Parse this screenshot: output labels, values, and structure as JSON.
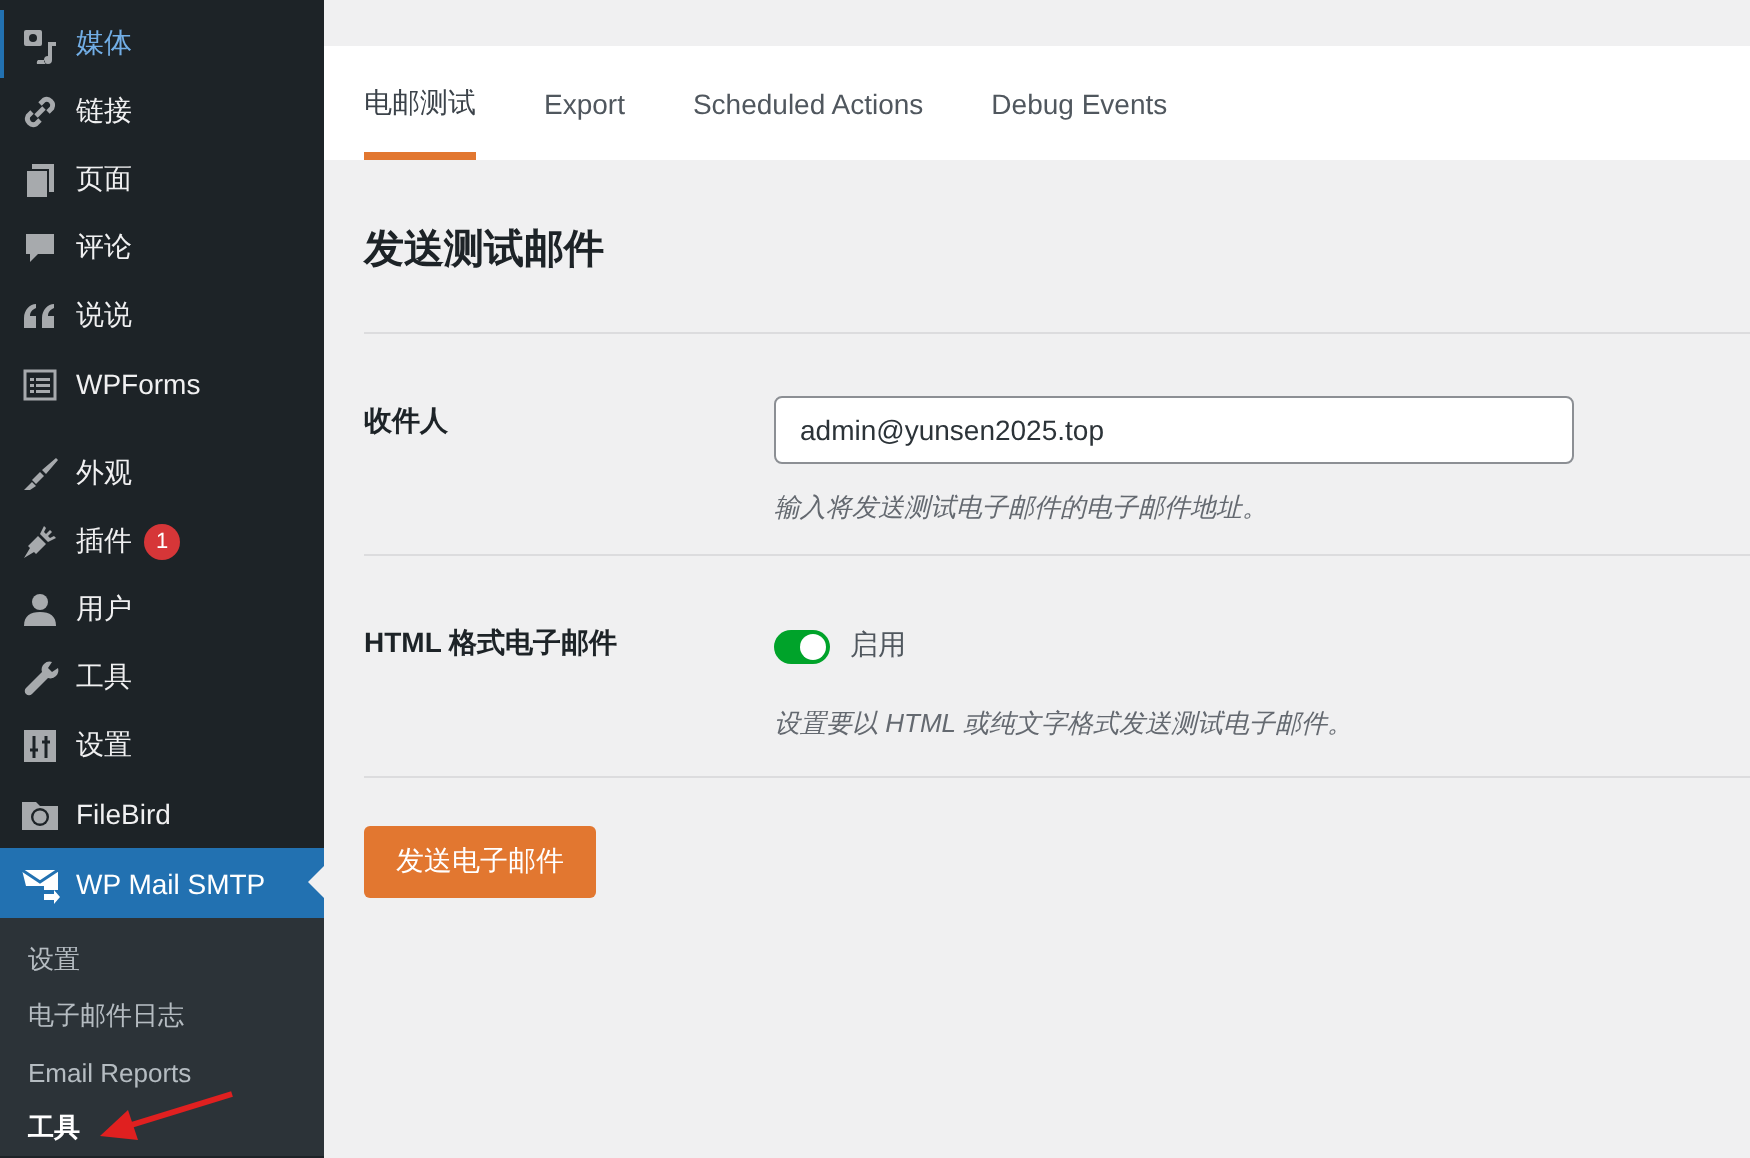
{
  "sidebar": {
    "items": [
      {
        "label": "媒体",
        "selected": false,
        "hovered": true
      },
      {
        "label": "链接",
        "selected": false,
        "hovered": false
      },
      {
        "label": "页面",
        "selected": false,
        "hovered": false
      },
      {
        "label": "评论",
        "selected": false,
        "hovered": false
      },
      {
        "label": "说说",
        "selected": false,
        "hovered": false
      },
      {
        "label": "WPForms",
        "selected": false,
        "hovered": false
      },
      {
        "label": "外观",
        "selected": false,
        "hovered": false
      },
      {
        "label": "插件",
        "selected": false,
        "hovered": false,
        "badge": "1"
      },
      {
        "label": "用户",
        "selected": false,
        "hovered": false
      },
      {
        "label": "工具",
        "selected": false,
        "hovered": false
      },
      {
        "label": "设置",
        "selected": false,
        "hovered": false
      },
      {
        "label": "FileBird",
        "selected": false,
        "hovered": false
      },
      {
        "label": "WP Mail SMTP",
        "selected": true,
        "hovered": false,
        "children": [
          {
            "label": "设置",
            "selected": false
          },
          {
            "label": "电子邮件日志",
            "selected": false
          },
          {
            "label": "Email Reports",
            "selected": false
          },
          {
            "label": "工具",
            "selected": true
          }
        ]
      }
    ]
  },
  "tabs": [
    {
      "label": "电邮测试",
      "selected": true
    },
    {
      "label": "Export",
      "selected": false
    },
    {
      "label": "Scheduled Actions",
      "selected": false
    },
    {
      "label": "Debug Events",
      "selected": false
    }
  ],
  "title": "发送测试邮件",
  "fields": [
    {
      "kind": "text",
      "label": "收件人",
      "value": "admin@yunsen2025.top",
      "help": "输入将发送测试电子邮件的电子邮件地址。"
    },
    {
      "kind": "toggle",
      "label": "HTML 格式电子邮件",
      "on": true,
      "toggle_label": "启用",
      "help": "设置要以 HTML 或纯文字格式发送测试电子邮件。"
    }
  ],
  "button": "发送电子邮件"
}
